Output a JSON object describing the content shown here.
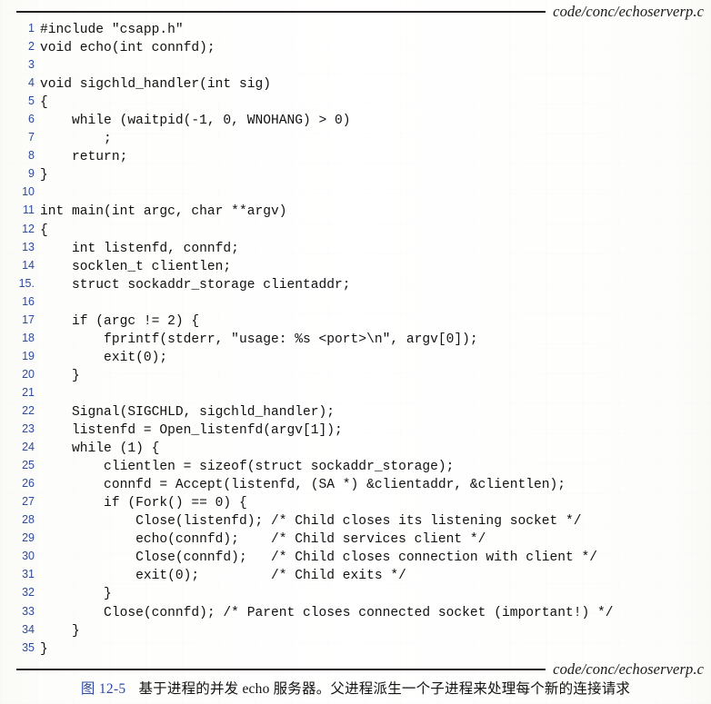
{
  "figure": {
    "header_file_label": "code/conc/echoserverp.c",
    "footer_file_label": "code/conc/echoserverp.c",
    "caption_number": "图 12-5",
    "caption_text": "基于进程的并发 echo 服务器。父进程派生一个子进程来处理每个新的连接请求",
    "colors": {
      "line_number": "#2e4a9e",
      "code_text": "#111111",
      "rule": "#231f20",
      "caption_number": "#2e4a9e",
      "page_background": "#ffffff"
    }
  },
  "code": {
    "language": "c",
    "total_lines": 35,
    "lines": [
      {
        "n": "1",
        "text": "#include \"csapp.h\""
      },
      {
        "n": "2",
        "text": "void echo(int connfd);"
      },
      {
        "n": "3",
        "text": ""
      },
      {
        "n": "4",
        "text": "void sigchld_handler(int sig)"
      },
      {
        "n": "5",
        "text": "{"
      },
      {
        "n": "6",
        "text": "    while (waitpid(-1, 0, WNOHANG) > 0)"
      },
      {
        "n": "7",
        "text": "        ;"
      },
      {
        "n": "8",
        "text": "    return;"
      },
      {
        "n": "9",
        "text": "}"
      },
      {
        "n": "10",
        "text": ""
      },
      {
        "n": "11",
        "text": "int main(int argc, char **argv)"
      },
      {
        "n": "12",
        "text": "{"
      },
      {
        "n": "13",
        "text": "    int listenfd, connfd;"
      },
      {
        "n": "14",
        "text": "    socklen_t clientlen;"
      },
      {
        "n": "15.",
        "text": "    struct sockaddr_storage clientaddr;"
      },
      {
        "n": "16",
        "text": ""
      },
      {
        "n": "17",
        "text": "    if (argc != 2) {"
      },
      {
        "n": "18",
        "text": "        fprintf(stderr, \"usage: %s <port>\\n\", argv[0]);"
      },
      {
        "n": "19",
        "text": "        exit(0);"
      },
      {
        "n": "20",
        "text": "    }"
      },
      {
        "n": "21",
        "text": ""
      },
      {
        "n": "22",
        "text": "    Signal(SIGCHLD, sigchld_handler);"
      },
      {
        "n": "23",
        "text": "    listenfd = Open_listenfd(argv[1]);"
      },
      {
        "n": "24",
        "text": "    while (1) {"
      },
      {
        "n": "25",
        "text": "        clientlen = sizeof(struct sockaddr_storage);"
      },
      {
        "n": "26",
        "text": "        connfd = Accept(listenfd, (SA *) &clientaddr, &clientlen);"
      },
      {
        "n": "27",
        "text": "        if (Fork() == 0) {"
      },
      {
        "n": "28",
        "text": "            Close(listenfd); /* Child closes its listening socket */"
      },
      {
        "n": "29",
        "text": "            echo(connfd);    /* Child services client */"
      },
      {
        "n": "30",
        "text": "            Close(connfd);   /* Child closes connection with client */"
      },
      {
        "n": "31",
        "text": "            exit(0);         /* Child exits */"
      },
      {
        "n": "32",
        "text": "        }"
      },
      {
        "n": "33",
        "text": "        Close(connfd); /* Parent closes connected socket (important!) */"
      },
      {
        "n": "34",
        "text": "    }"
      },
      {
        "n": "35",
        "text": "}"
      }
    ]
  }
}
